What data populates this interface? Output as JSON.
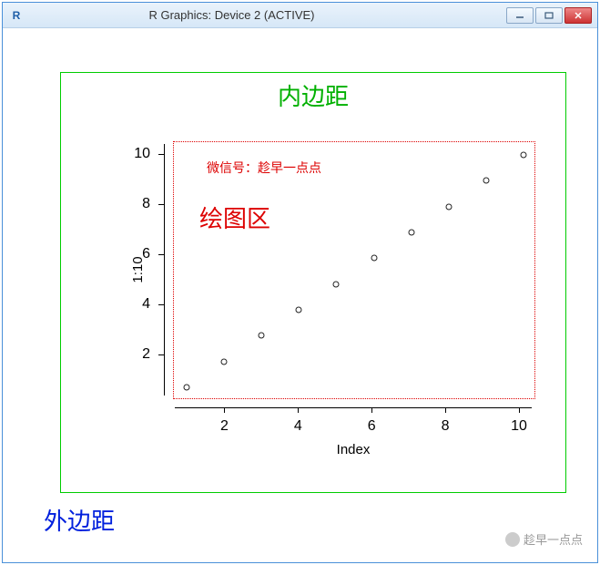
{
  "window": {
    "title": "R Graphics: Device 2 (ACTIVE)",
    "app_icon_letter": "R"
  },
  "labels": {
    "outer_margin": "外边距",
    "inner_margin": "内边距",
    "plot_region": "绘图区",
    "wechat": "微信号：趁早一点点",
    "watermark": "趁早一点点"
  },
  "chart_data": {
    "type": "scatter",
    "title": "",
    "xlabel": "Index",
    "ylabel": "1:10",
    "xlim": [
      1,
      10
    ],
    "ylim": [
      1,
      10
    ],
    "xticks": [
      2,
      4,
      6,
      8,
      10
    ],
    "yticks": [
      2,
      4,
      6,
      8,
      10
    ],
    "x": [
      1,
      2,
      3,
      4,
      5,
      6,
      7,
      8,
      9,
      10
    ],
    "y": [
      1,
      2,
      3,
      4,
      5,
      6,
      7,
      8,
      9,
      10
    ]
  }
}
